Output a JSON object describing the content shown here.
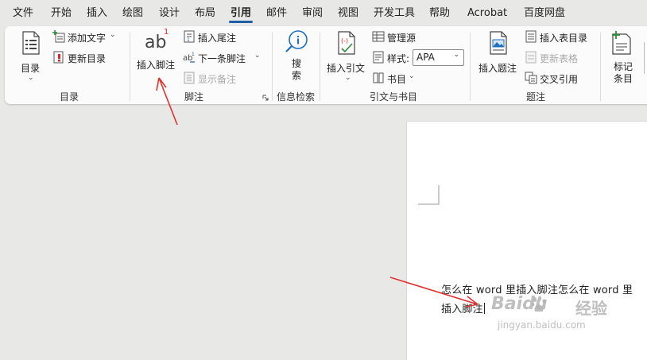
{
  "menu": {
    "tabs": [
      {
        "label": "文件",
        "active": false
      },
      {
        "label": "开始",
        "active": false
      },
      {
        "label": "插入",
        "active": false
      },
      {
        "label": "绘图",
        "active": false
      },
      {
        "label": "设计",
        "active": false
      },
      {
        "label": "布局",
        "active": false
      },
      {
        "label": "引用",
        "active": true
      },
      {
        "label": "邮件",
        "active": false
      },
      {
        "label": "审阅",
        "active": false
      },
      {
        "label": "视图",
        "active": false
      },
      {
        "label": "开发工具",
        "active": false
      },
      {
        "label": "帮助",
        "active": false
      },
      {
        "label": "Acrobat",
        "active": false
      },
      {
        "label": "百度网盘",
        "active": false
      }
    ]
  },
  "ribbon": {
    "toc": {
      "toc_button": "目录",
      "add_text": "添加文字",
      "update_toc": "更新目录",
      "group_label": "目录"
    },
    "footnotes": {
      "insert_footnote": "插入脚注",
      "footnote_icon_text": "ab",
      "footnote_superscript": "1",
      "insert_endnote": "插入尾注",
      "next_footnote": "下一条脚注",
      "show_notes": "显示备注",
      "group_label": "脚注"
    },
    "research": {
      "search": "搜索",
      "group_label": "信息检索"
    },
    "citations": {
      "insert_citation": "插入引文",
      "manage_sources": "管理源",
      "style_label": "样式:",
      "style_value": "APA",
      "bibliography": "书目",
      "group_label": "引文与书目"
    },
    "captions": {
      "insert_caption": "插入题注",
      "insert_table_of_figures": "插入表目录",
      "update_table": "更新表格",
      "cross_reference": "交叉引用",
      "group_label": "题注"
    },
    "index": {
      "mark_entry": "标记条目"
    }
  },
  "document": {
    "line1": "怎么在 word 里插入脚注怎么在 word 里",
    "line2": "插入脚注"
  },
  "watermark": {
    "brand": "Baidu",
    "brand_cn": "经验",
    "url": "jingyan.baidu.com"
  },
  "colors": {
    "accent": "#1f5fa8",
    "annotation_arrow": "#e0312f",
    "ribbon_bg": "#fbfbfb",
    "canvas_bg": "#e8e8e6"
  }
}
